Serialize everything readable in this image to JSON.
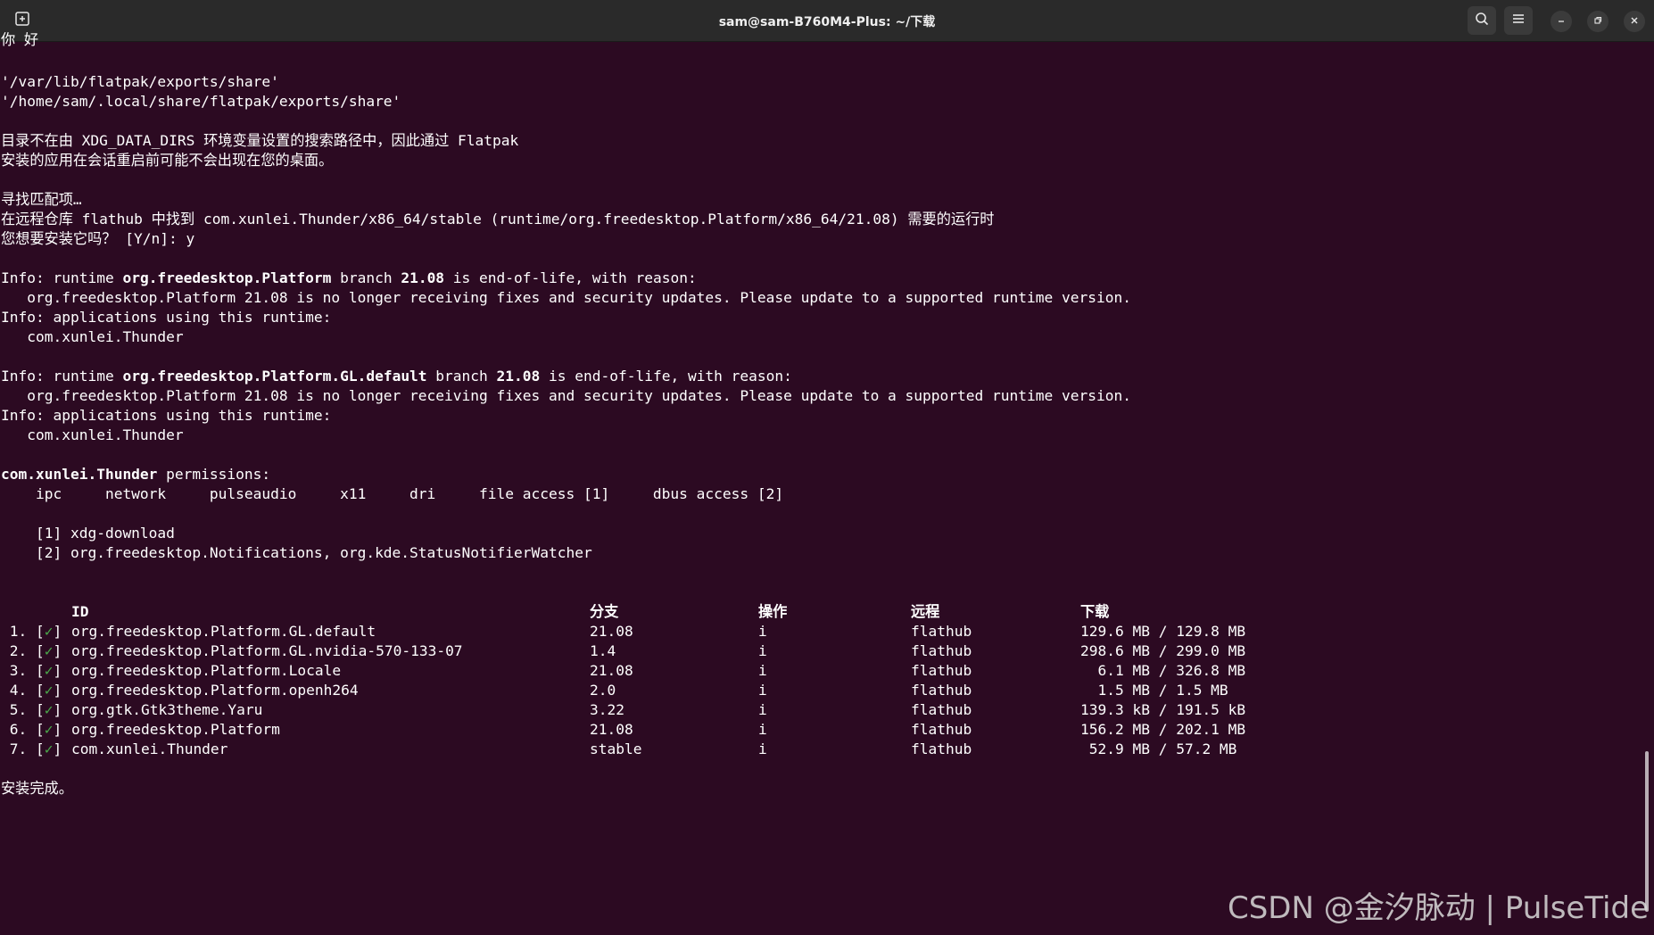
{
  "titlebar": {
    "title": "sam@sam-B760M4-Plus: ~/下载",
    "icons": [
      "new-tab-icon",
      "search-icon",
      "hamburger-menu-icon",
      "minimize-icon",
      "restore-icon",
      "close-icon"
    ]
  },
  "output": {
    "partial_top": "你 好",
    "path1": "'/var/lib/flatpak/exports/share'",
    "path2": "'/home/sam/.local/share/flatpak/exports/share'",
    "xdg1": "目录不在由 XDG_DATA_DIRS 环境变量设置的搜索路径中，因此通过 Flatpak",
    "xdg2": "安装的应用在会话重启前可能不会出现在您的桌面。",
    "search": "寻找匹配项…",
    "found": "在远程仓库 flathub 中找到 com.xunlei.Thunder/x86_64/stable (runtime/org.freedesktop.Platform/x86_64/21.08) 需要的运行时",
    "prompt": "您想要安装它吗？ [Y/n]: y",
    "eol1": {
      "pre": "Info: runtime ",
      "name": "org.freedesktop.Platform",
      "mid": " branch ",
      "branch": "21.08",
      "post": " is end-of-life, with reason:"
    },
    "eol1_reason": "   org.freedesktop.Platform 21.08 is no longer receiving fixes and security updates. Please update to a supported runtime version.",
    "eol1_apps": "Info: applications using this runtime:",
    "eol1_app": "   com.xunlei.Thunder",
    "eol2": {
      "pre": "Info: runtime ",
      "name": "org.freedesktop.Platform.GL.default",
      "mid": " branch ",
      "branch": "21.08",
      "post": " is end-of-life, with reason:"
    },
    "eol2_reason": "   org.freedesktop.Platform 21.08 is no longer receiving fixes and security updates. Please update to a supported runtime version.",
    "eol2_apps": "Info: applications using this runtime:",
    "eol2_app": "   com.xunlei.Thunder",
    "perm_app": "com.xunlei.Thunder",
    "perm_label": " permissions:",
    "perms": "    ipc     network     pulseaudio     x11     dri     file access [1]     dbus access [2]",
    "perm_note1": "    [1] xdg-download",
    "perm_note2": "    [2] org.freedesktop.Notifications, org.kde.StatusNotifierWatcher",
    "done": "安装完成。"
  },
  "table": {
    "headers": {
      "id": "ID",
      "branch": "分支",
      "op": "操作",
      "remote": "远程",
      "download": "下载"
    },
    "check": "✓",
    "rows": [
      {
        "num": " 1.",
        "id": "org.freedesktop.Platform.GL.default",
        "branch": "21.08",
        "op": "i",
        "remote": "flathub",
        "download": "129.6 MB / 129.8 MB"
      },
      {
        "num": " 2.",
        "id": "org.freedesktop.Platform.GL.nvidia-570-133-07",
        "branch": "1.4",
        "op": "i",
        "remote": "flathub",
        "download": "298.6 MB / 299.0 MB"
      },
      {
        "num": " 3.",
        "id": "org.freedesktop.Platform.Locale",
        "branch": "21.08",
        "op": "i",
        "remote": "flathub",
        "download": "  6.1 MB / 326.8 MB"
      },
      {
        "num": " 4.",
        "id": "org.freedesktop.Platform.openh264",
        "branch": "2.0",
        "op": "i",
        "remote": "flathub",
        "download": "  1.5 MB / 1.5 MB"
      },
      {
        "num": " 5.",
        "id": "org.gtk.Gtk3theme.Yaru",
        "branch": "3.22",
        "op": "i",
        "remote": "flathub",
        "download": "139.3 kB / 191.5 kB"
      },
      {
        "num": " 6.",
        "id": "org.freedesktop.Platform",
        "branch": "21.08",
        "op": "i",
        "remote": "flathub",
        "download": "156.2 MB / 202.1 MB"
      },
      {
        "num": " 7.",
        "id": "com.xunlei.Thunder",
        "branch": "stable",
        "op": "i",
        "remote": "flathub",
        "download": " 52.9 MB / 57.2 MB"
      }
    ]
  },
  "watermark": "CSDN @金汐脉动 | PulseTide",
  "colors": {
    "terminal_bg": "#2c0a22",
    "titlebar_bg": "#2a2a2a",
    "text": "#ffffff",
    "check": "#4aa94a"
  }
}
